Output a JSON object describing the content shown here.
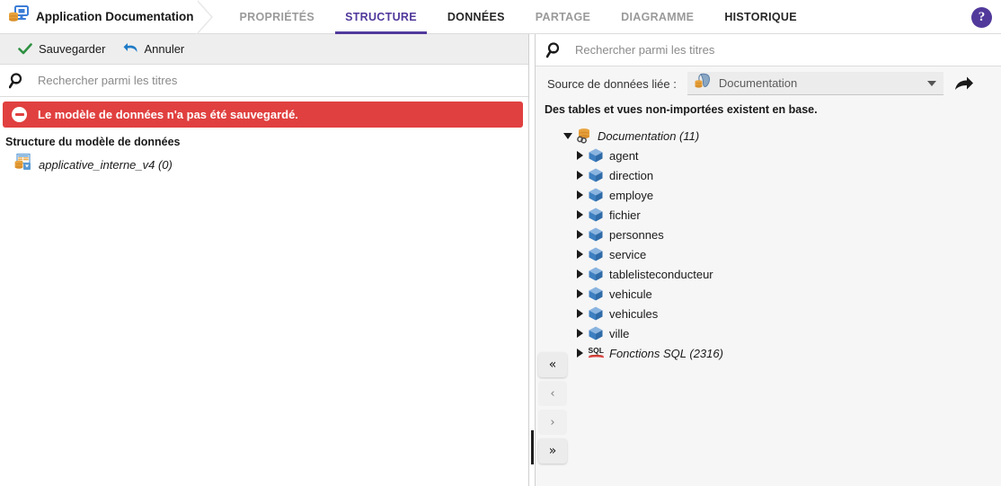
{
  "app": {
    "title": "Application Documentation",
    "logo_icon": "database-screen-icon",
    "help_icon": "help-question-icon"
  },
  "tabs": [
    {
      "label": "PROPRIÉTÉS",
      "state": "inactive"
    },
    {
      "label": "STRUCTURE",
      "state": "active"
    },
    {
      "label": "DONNÉES",
      "state": "inactive"
    },
    {
      "label": "PARTAGE",
      "state": "muted"
    },
    {
      "label": "DIAGRAMME",
      "state": "muted"
    },
    {
      "label": "HISTORIQUE",
      "state": "inactive"
    }
  ],
  "left": {
    "toolbar": {
      "save_label": "Sauvegarder",
      "save_icon": "check-icon",
      "cancel_label": "Annuler",
      "cancel_icon": "undo-arrow-icon"
    },
    "search": {
      "placeholder": "Rechercher parmi les titres",
      "value": "",
      "icon": "search-icon"
    },
    "error": {
      "text": "Le modèle de données n'a pas été sauvegardé.",
      "icon": "error-minus-icon",
      "color": "#e0403f"
    },
    "section_title": "Structure du modèle de données",
    "model": {
      "label": "applicative_interne_v4 (0)",
      "icon": "data-model-icon"
    }
  },
  "right": {
    "search": {
      "placeholder": "Rechercher parmi les titres",
      "value": "",
      "icon": "search-icon"
    },
    "datasource": {
      "label": "Source de données liée :",
      "selected": "Documentation",
      "icon": "postgresql-database-icon",
      "caret_icon": "chevron-down-icon",
      "goto_icon": "share-arrow-icon"
    },
    "note": "Des tables et vues non-importées existent en base.",
    "tree": {
      "root": {
        "label": "Documentation (11)",
        "icon": "linked-database-icon",
        "expanded": true
      },
      "children": [
        {
          "label": "agent",
          "icon": "table-cube-icon"
        },
        {
          "label": "direction",
          "icon": "table-cube-icon"
        },
        {
          "label": "employe",
          "icon": "table-cube-icon"
        },
        {
          "label": "fichier",
          "icon": "table-cube-icon"
        },
        {
          "label": "personnes",
          "icon": "table-cube-icon"
        },
        {
          "label": "service",
          "icon": "table-cube-icon"
        },
        {
          "label": "tablelisteconducteur",
          "icon": "table-cube-icon"
        },
        {
          "label": "vehicule",
          "icon": "table-cube-icon"
        },
        {
          "label": "vehicules",
          "icon": "table-cube-icon"
        },
        {
          "label": "ville",
          "icon": "table-cube-icon"
        }
      ],
      "functions": {
        "label": "Fonctions SQL (2316)",
        "icon": "sql-function-icon"
      }
    }
  },
  "nav_buttons": [
    {
      "label": "«",
      "name": "move-all-left-button"
    },
    {
      "label": "‹",
      "name": "move-left-button"
    },
    {
      "label": "›",
      "name": "move-right-button"
    },
    {
      "label": "»",
      "name": "move-all-right-button"
    }
  ],
  "theme": {
    "accent": "#51399b",
    "error": "#e0403f",
    "panel_bg": "#f6f6f6"
  }
}
